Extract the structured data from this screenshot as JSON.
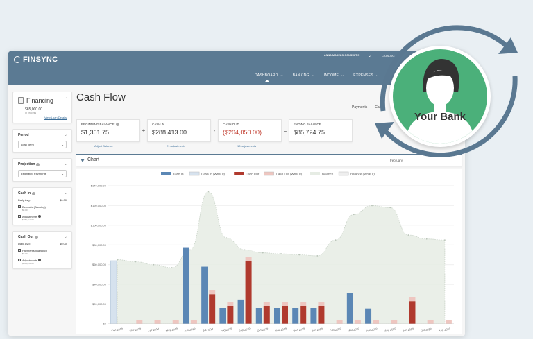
{
  "app": {
    "logo": "FINSYNC",
    "user": "ANNA MAKELO CONSULTIN",
    "catalog": "CATALOG"
  },
  "nav": [
    {
      "label": "DASHBOARD"
    },
    {
      "label": "BANKING"
    },
    {
      "label": "INCOME"
    },
    {
      "label": "EXPENSES"
    }
  ],
  "sidebar": {
    "financing": {
      "title": "Financing",
      "amount": "$65,000.00",
      "sub": "In process",
      "link": "View Loan Details"
    },
    "period": {
      "title": "Period",
      "value": "Loan Term"
    },
    "projection": {
      "title": "Projection",
      "value": "Estimated Payments"
    },
    "cash_in": {
      "title": "Cash In",
      "daily_label": "Daily Avg:",
      "daily_value": "$0.00",
      "deposits": "Deposits (Banking)",
      "deposits_val": "$0.00",
      "adjustments": "Adjustments",
      "adjustments_val": "$288,413.00"
    },
    "cash_out": {
      "title": "Cash Out",
      "daily_label": "Daily Avg:",
      "daily_value": "$0.00",
      "payments": "Payments (Banking)",
      "payments_val": "$0.00",
      "adjustments": "Adjustments",
      "adjustments_val": "$204,050.00"
    }
  },
  "main": {
    "title": "Cash Flow",
    "tabs": [
      "Payments",
      "Cash"
    ],
    "balances": {
      "beginning_label": "BEGINNING BALANCE",
      "beginning_value": "$1,361.75",
      "beginning_link": "Adjust Balance",
      "in_label": "CASH IN",
      "in_value": "$288,413.00",
      "in_link": "21 adjustments",
      "out_label": "CASH OUT",
      "out_value": "($204,050.00)",
      "out_link": "18 adjustments",
      "ending_label": "ENDING BALANCE",
      "ending_value": "$85,724.75",
      "plus": "+",
      "minus": "-",
      "equals": "="
    },
    "chart_header": {
      "label": "Chart",
      "date": "February"
    }
  },
  "overlay": {
    "bank_label": "Your Bank"
  },
  "colors": {
    "topbar": "#5b7a93",
    "cash_in": "#5b87b5",
    "cash_out": "#b03a2e",
    "balance": "#e6ece4",
    "bank": "#4bb07a"
  },
  "chart_data": {
    "type": "bar",
    "legend": [
      "Cash In",
      "Cash In (What If)",
      "Cash Out",
      "Cash Out (What If)",
      "Balance",
      "Balance (What If)"
    ],
    "legend_position": "top",
    "y_ticks": [
      "$140,000.00",
      "$120,000.00",
      "$100,000.00",
      "$80,000.00",
      "$60,000.00",
      "$40,000.00",
      "$20,000.00",
      "$0"
    ],
    "ylim": [
      0,
      140000
    ],
    "categories": [
      "Feb 2019",
      "Mar 2019",
      "Apr 2019",
      "May 2019",
      "Jun 2019",
      "Jul 2019",
      "Aug 2019",
      "Sep 2019",
      "Oct 2019",
      "Nov 2019",
      "Dec 2019",
      "Jan 2020",
      "Feb 2020",
      "Mar 2020",
      "Apr 2020",
      "May 2020",
      "Jun 2020",
      "Jul 2020",
      "Aug 2020"
    ],
    "series": [
      {
        "name": "Cash In",
        "values": [
          0,
          0,
          0,
          0,
          77000,
          58000,
          16000,
          24000,
          16000,
          16000,
          16000,
          16000,
          0,
          31000,
          15000,
          0,
          0,
          0,
          0
        ]
      },
      {
        "name": "Cash In (What If)",
        "values": [
          64000,
          0,
          0,
          0,
          0,
          0,
          0,
          0,
          0,
          0,
          0,
          0,
          0,
          0,
          0,
          0,
          0,
          0,
          0
        ]
      },
      {
        "name": "Cash Out",
        "values": [
          0,
          0,
          0,
          0,
          0,
          30000,
          18000,
          64000,
          18000,
          18000,
          18000,
          18000,
          0,
          0,
          0,
          0,
          23000,
          0,
          0
        ]
      },
      {
        "name": "Cash Out (What If)",
        "values": [
          0,
          4000,
          4000,
          4000,
          4000,
          4000,
          4000,
          4000,
          4000,
          4000,
          4000,
          4000,
          4000,
          4000,
          4000,
          4000,
          4000,
          4000,
          4000
        ]
      },
      {
        "name": "Balance",
        "values": [
          65000,
          63000,
          60000,
          57000,
          75000,
          134000,
          87000,
          75000,
          72000,
          71000,
          70000,
          69000,
          85000,
          111000,
          120000,
          118000,
          90000,
          86000,
          85000
        ]
      }
    ]
  }
}
